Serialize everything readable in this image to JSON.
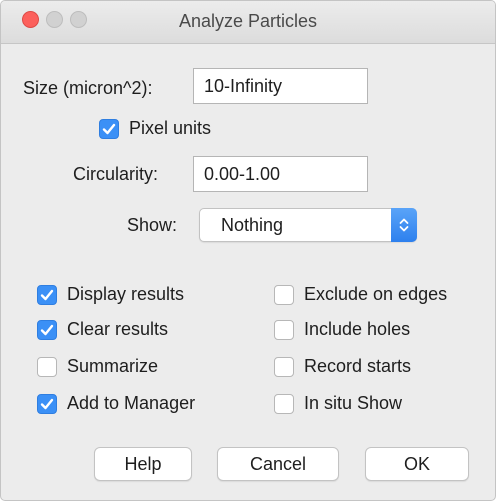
{
  "window": {
    "title": "Analyze Particles"
  },
  "size": {
    "label": "Size (micron^2):",
    "value": "10-Infinity"
  },
  "pixel_units": {
    "label": "Pixel units",
    "checked": true
  },
  "circularity": {
    "label": "Circularity:",
    "value": "0.00-1.00"
  },
  "show": {
    "label": "Show:",
    "selected": "Nothing"
  },
  "options_left": [
    {
      "label": "Display results",
      "checked": true
    },
    {
      "label": "Clear results",
      "checked": true
    },
    {
      "label": "Summarize",
      "checked": false
    },
    {
      "label": "Add to Manager",
      "checked": true
    }
  ],
  "options_right": [
    {
      "label": "Exclude on edges",
      "checked": false
    },
    {
      "label": "Include holes",
      "checked": false
    },
    {
      "label": "Record starts",
      "checked": false
    },
    {
      "label": "In situ Show",
      "checked": false
    }
  ],
  "buttons": {
    "help": "Help",
    "cancel": "Cancel",
    "ok": "OK"
  },
  "colors": {
    "accent": "#3b90f6",
    "close": "#fc605c",
    "inactive_light": "#d1d1d1"
  },
  "icons": {
    "checkmark": "checkmark-icon",
    "select_arrows": "up-down-chevron-icon"
  }
}
